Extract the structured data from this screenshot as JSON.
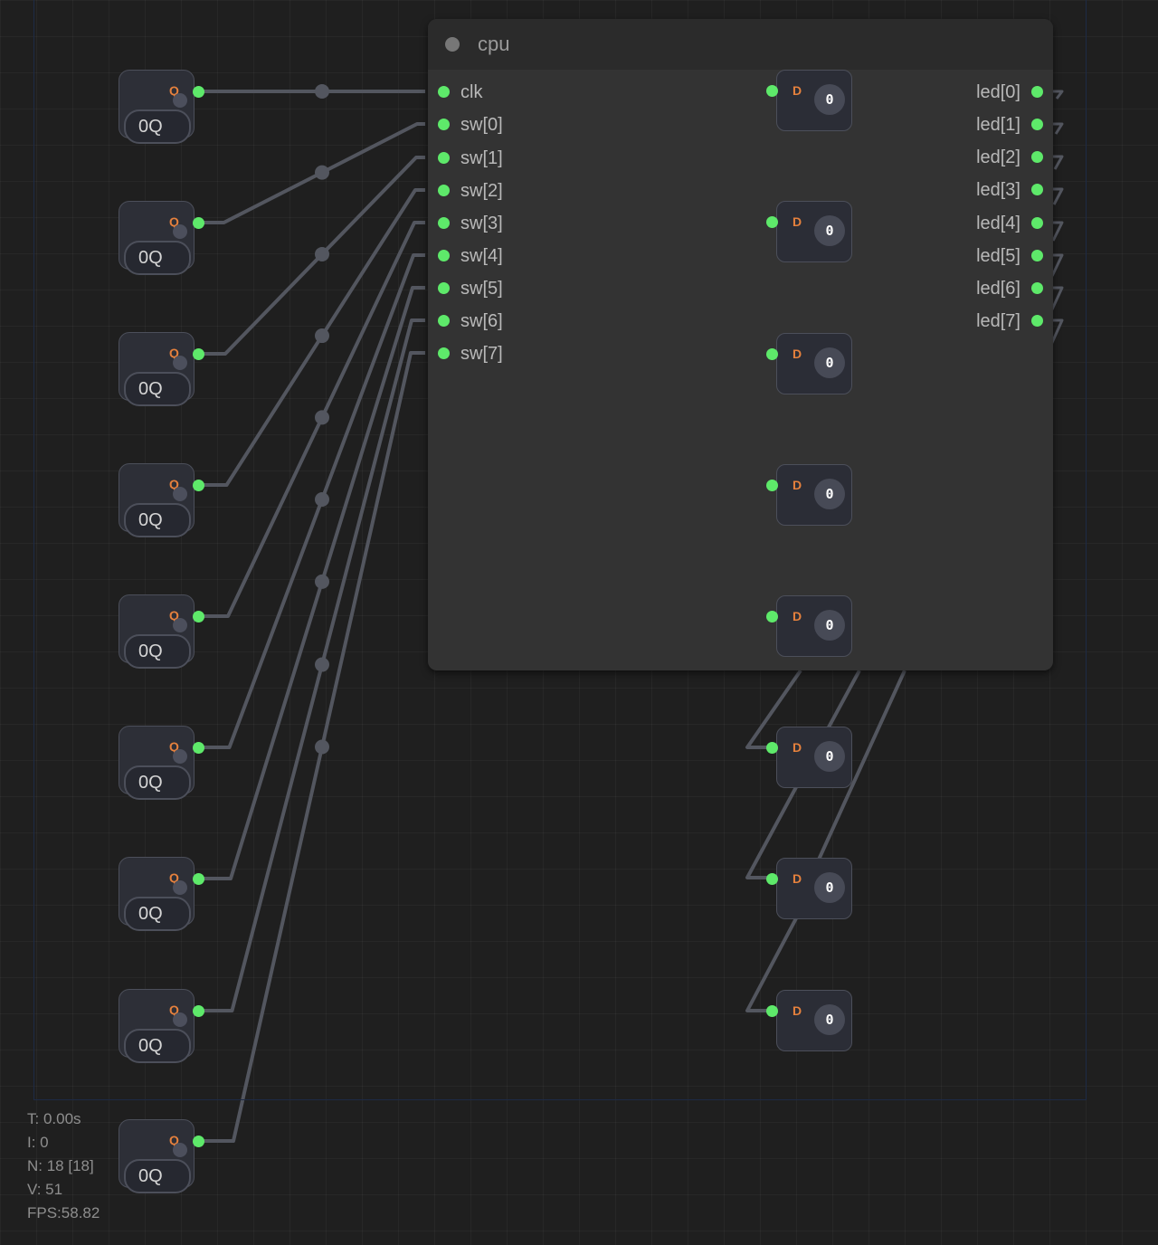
{
  "cpu": {
    "title": "cpu",
    "inputs": [
      "clk",
      "sw[0]",
      "sw[1]",
      "sw[2]",
      "sw[3]",
      "sw[4]",
      "sw[5]",
      "sw[6]",
      "sw[7]"
    ],
    "outputs": [
      "led[0]",
      "led[1]",
      "led[2]",
      "led[3]",
      "led[4]",
      "led[5]",
      "led[6]",
      "led[7]"
    ]
  },
  "switches": [
    {
      "port": "Q",
      "label": "0Q"
    },
    {
      "port": "Q",
      "label": "0Q"
    },
    {
      "port": "Q",
      "label": "0Q"
    },
    {
      "port": "Q",
      "label": "0Q"
    },
    {
      "port": "Q",
      "label": "0Q"
    },
    {
      "port": "Q",
      "label": "0Q"
    },
    {
      "port": "Q",
      "label": "0Q"
    },
    {
      "port": "Q",
      "label": "0Q"
    },
    {
      "port": "Q",
      "label": "0Q"
    }
  ],
  "flipflops": [
    {
      "port": "D",
      "value": "0"
    },
    {
      "port": "D",
      "value": "0"
    },
    {
      "port": "D",
      "value": "0"
    },
    {
      "port": "D",
      "value": "0"
    },
    {
      "port": "D",
      "value": "0"
    },
    {
      "port": "D",
      "value": "0"
    },
    {
      "port": "D",
      "value": "0"
    },
    {
      "port": "D",
      "value": "0"
    }
  ],
  "stats": {
    "time": "T: 0.00s",
    "iterations": "I: 0",
    "nodes": "N: 18 [18]",
    "vertices": "V: 51",
    "fps": "FPS:58.82"
  },
  "colors": {
    "background": "#1f1f1f",
    "wire": "#53565f",
    "port": "#5ee96a",
    "port_label_accent": "#e6813d"
  }
}
